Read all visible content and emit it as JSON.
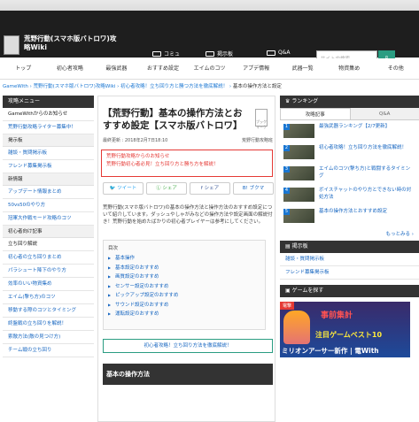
{
  "site": {
    "title": "荒野行動(スマホ版バトロワ)攻略Wiki",
    "nav": [
      "コミュ",
      "掲示板",
      "Q&A"
    ],
    "search_placeholder": "サイト内検索",
    "search_icon": "search-icon"
  },
  "menu": [
    "トップ",
    "初心者攻略",
    "最強武器",
    "おすすめ設定",
    "エイムのコツ",
    "アプデ情報",
    "武器一覧",
    "物資集め",
    "その他"
  ],
  "breadcrumb": {
    "items": [
      "GameWith",
      "荒野行動(スマホ版バトロワ)攻略Wiki",
      "初心者攻略！立ち回り方と勝つ方法を徹底解説！"
    ],
    "current": "基本の操作方法と設定"
  },
  "left": {
    "header": "攻略メニュー",
    "items": [
      {
        "label": "GameWithからのお知らせ",
        "type": "dark"
      },
      {
        "label": "荒野行動攻略ライター募集中！",
        "type": "link"
      },
      {
        "label": "掲示板",
        "type": "section"
      },
      {
        "label": "雑談・質問掲示板",
        "type": "link"
      },
      {
        "label": "フレンド募集掲示板",
        "type": "link"
      },
      {
        "label": "新情報",
        "type": "section"
      },
      {
        "label": "アップデート情報まとめ",
        "type": "link"
      },
      {
        "label": "50vs50のやり方",
        "type": "link"
      },
      {
        "label": "冠軍大作戦モード攻略のコツ",
        "type": "link"
      },
      {
        "label": "初心者向け記事",
        "type": "section"
      },
      {
        "label": "立ち回り解説",
        "type": "dark"
      },
      {
        "label": "初心者の立ち回りまとめ",
        "type": "link"
      },
      {
        "label": "パラシュート降下のやり方",
        "type": "link"
      },
      {
        "label": "効率のいい物資集め",
        "type": "link"
      },
      {
        "label": "エイム(撃ち方)のコツ",
        "type": "link"
      },
      {
        "label": "移動する際のコツとタイミング",
        "type": "link"
      },
      {
        "label": "終盤戦の立ち回りを解説！",
        "type": "link"
      },
      {
        "label": "索敵方法(敵の見つけ方)",
        "type": "link"
      },
      {
        "label": "チーム戦の立ち回り",
        "type": "link"
      }
    ]
  },
  "article": {
    "title": "【荒野行動】基本の操作方法とおすすめ設定【スマホ版バトロワ】",
    "bookmark": "ブックマーク",
    "updated": "最終更新 : 2018年2月7日18:10",
    "author": "荒野行動攻略班",
    "notice_head": "荒野行動攻略からのお知らせ",
    "notice_link": "荒野行動初心者必見！立ち回り方と勝ち方を解説！",
    "share": [
      "ツイート",
      "シェア",
      "シェア",
      "ブクマ"
    ],
    "intro": "荒野行動(スマホ版バトロワ)の基本の操作方法と操作方法のおすすめ設定について紹介しています。ダッシュやしゃがみなどの操作方法や設定画面の解説付き！荒野行動を始めたばかりの初心者プレイヤーは参考にしてください。",
    "toc_title": "目次",
    "toc": [
      "基本操作",
      "基本設定のおすすめ",
      "画質設定のおすすめ",
      "センサー設定のおすすめ",
      "ピックアップ設定のおすすめ",
      "サウンド設定のおすすめ",
      "運転設定のおすすめ"
    ],
    "green_link": "初心者攻略！立ち回り方法を徹底解説！",
    "section": "基本の操作方法"
  },
  "right": {
    "ranking_header": "ランキング",
    "tabs": [
      "攻略記事",
      "Q&A"
    ],
    "ranks": [
      {
        "num": "1",
        "text": "最強武器ランキング【2/7更新】"
      },
      {
        "num": "2",
        "text": "初心者攻略！立ち回り方法を徹底解説！"
      },
      {
        "num": "3",
        "text": "エイムのコツ(撃ち方)と戦闘するタイミング"
      },
      {
        "num": "4",
        "text": "ボイスチャットのやり方とできない時の対処方法"
      },
      {
        "num": "5",
        "text": "基本の操作方法とおすすめ設定"
      }
    ],
    "more": "もっとみる ›",
    "board_header": "掲示板",
    "boards": [
      "雑談・質問掲示板",
      "フレンド募集掲示板"
    ],
    "game_header": "ゲームを探す",
    "ad": {
      "tag": "電撃",
      "t1": "事前集計",
      "t2": "注目ゲームベスト10",
      "t3": "ミリオンアーサー新作 | 電With"
    }
  }
}
